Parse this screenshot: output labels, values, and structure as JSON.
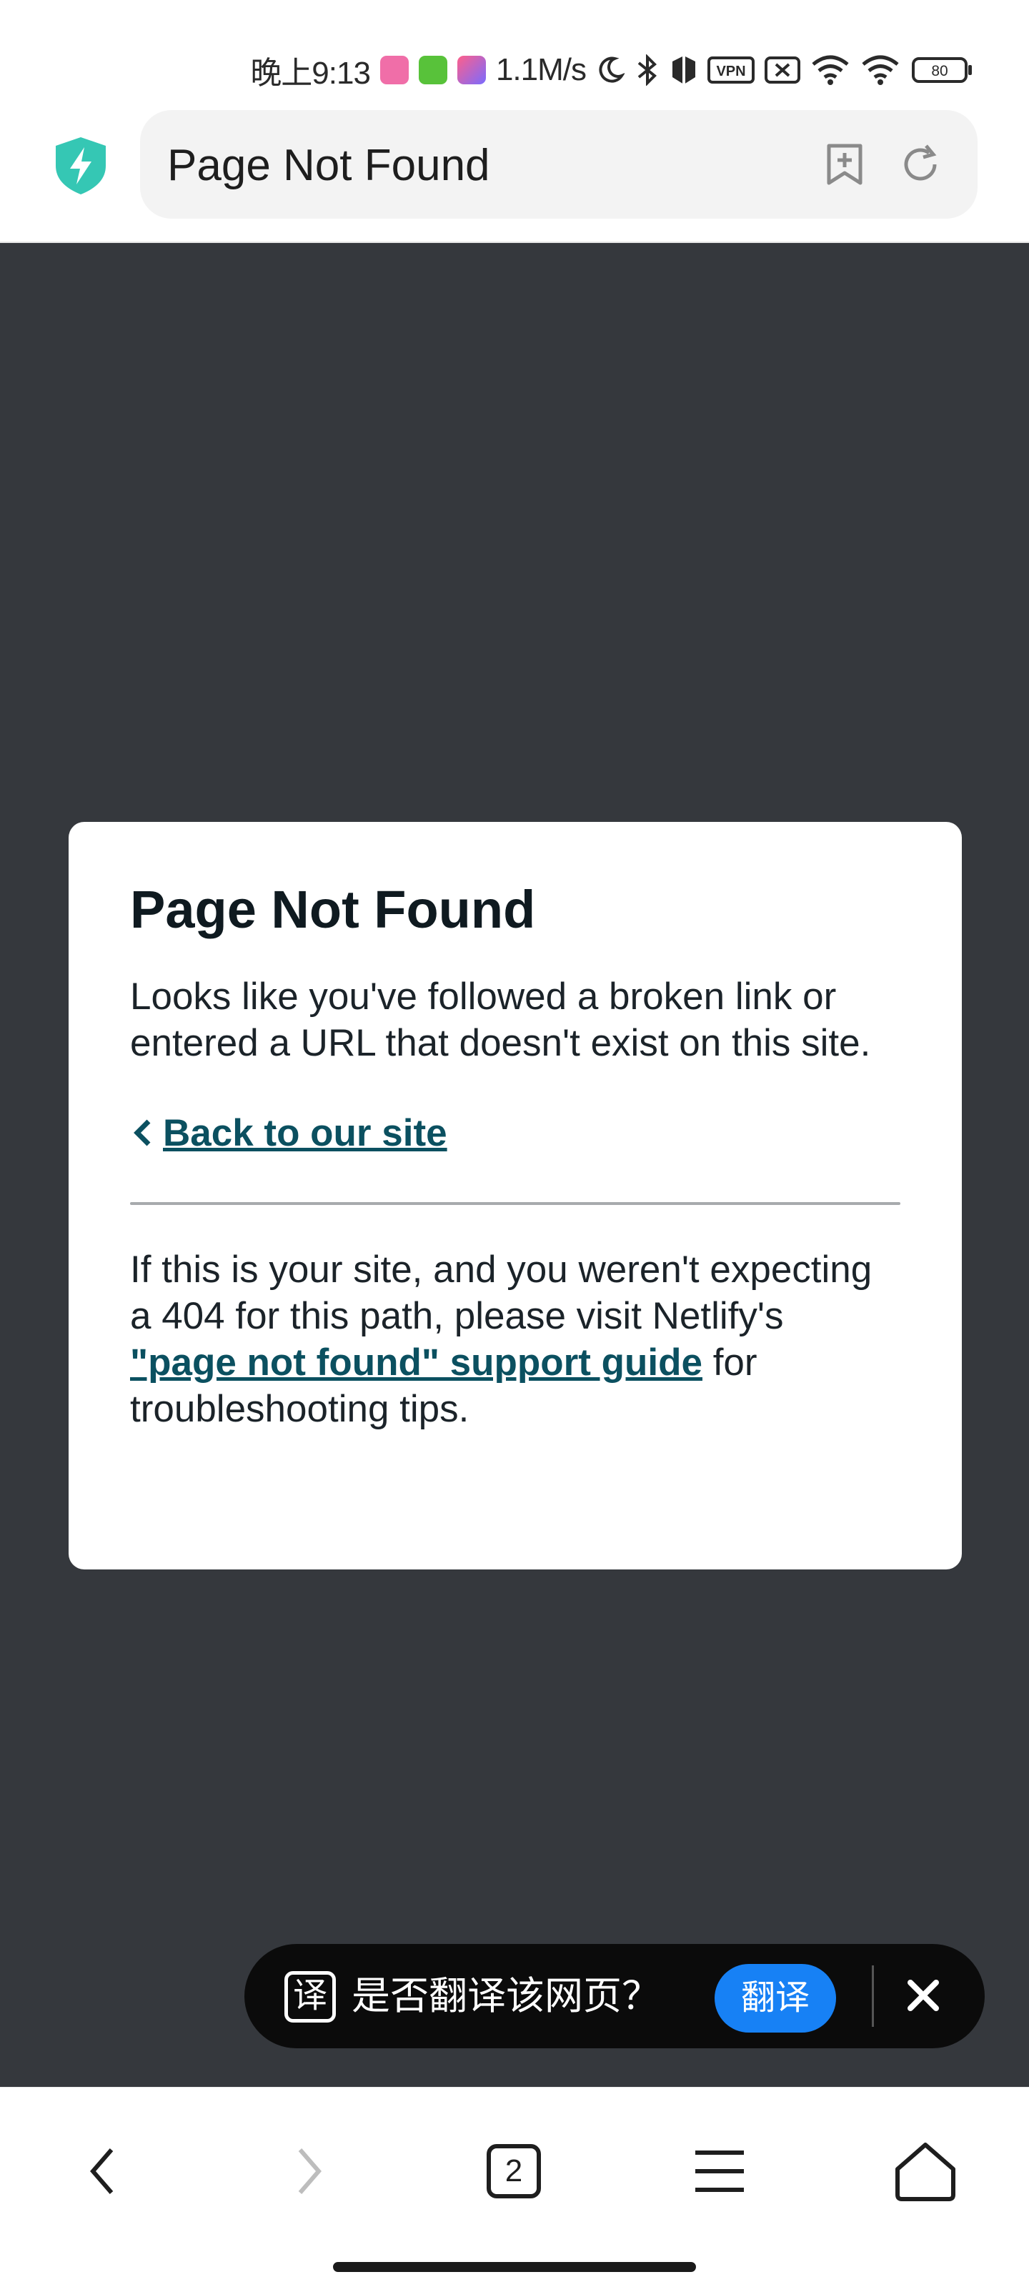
{
  "status_bar": {
    "time": "晚上9:13",
    "network_speed": "1.1M/s",
    "vpn_label": "VPN",
    "battery": "80"
  },
  "address_bar": {
    "page_title": "Page Not Found"
  },
  "card": {
    "title": "Page Not Found",
    "message": "Looks like you've followed a broken link or entered a URL that doesn't exist on this site.",
    "back_link": "Back to our site",
    "help_prefix": "If this is your site, and you weren't expecting a 404 for this path, please visit Netlify's ",
    "help_link": "\"page not found\" support guide",
    "help_suffix": " for troubleshooting tips."
  },
  "translate_banner": {
    "icon_glyph": "译",
    "question": "是否翻译该网页？",
    "translate_button": "翻译"
  },
  "bottom_nav": {
    "tab_count": "2"
  },
  "colors": {
    "page_background": "#35383d",
    "link": "#0b5060",
    "translate_button": "#1781f5",
    "shield_icon": "#35c7b4"
  }
}
